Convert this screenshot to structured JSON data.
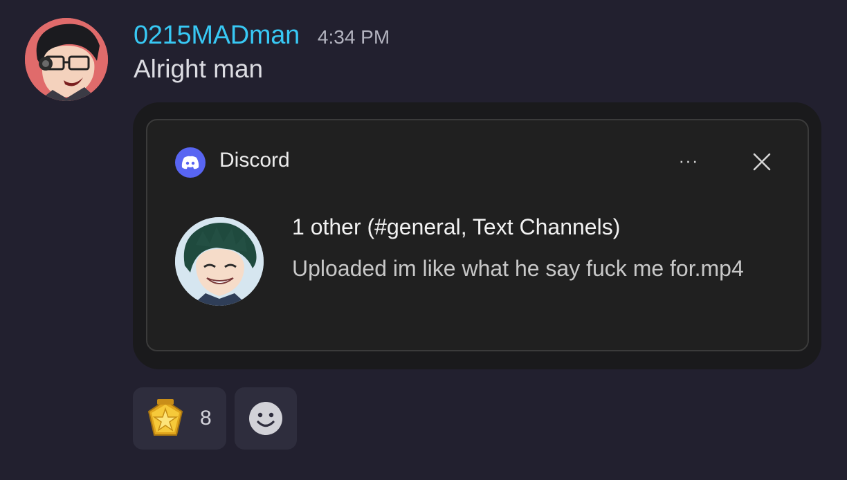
{
  "message": {
    "author": "0215MADman",
    "timestamp": "4:34 PM",
    "text": "Alright man",
    "author_avatar_icon": "cartoon-glasses-avatar-icon"
  },
  "attachment": {
    "toast": {
      "app_icon": "discord-logo-icon",
      "app_name": "Discord",
      "more_icon": "more-options-icon",
      "more_label": "···",
      "close_icon": "close-icon",
      "sender_avatar_icon": "anime-boy-avatar-icon",
      "title": "1 other (#general, Text Channels)",
      "body": "Uploaded im like what he say fuck me for.mp4"
    }
  },
  "reactions": [
    {
      "emoji_icon": "gold-star-badge-icon",
      "count": "8"
    }
  ],
  "add_reaction_icon": "smiley-add-reaction-icon",
  "colors": {
    "background": "#22202f",
    "username": "#38c8f4",
    "discord_blurple": "#5865f2",
    "reaction_bg": "#2e2d3d"
  }
}
